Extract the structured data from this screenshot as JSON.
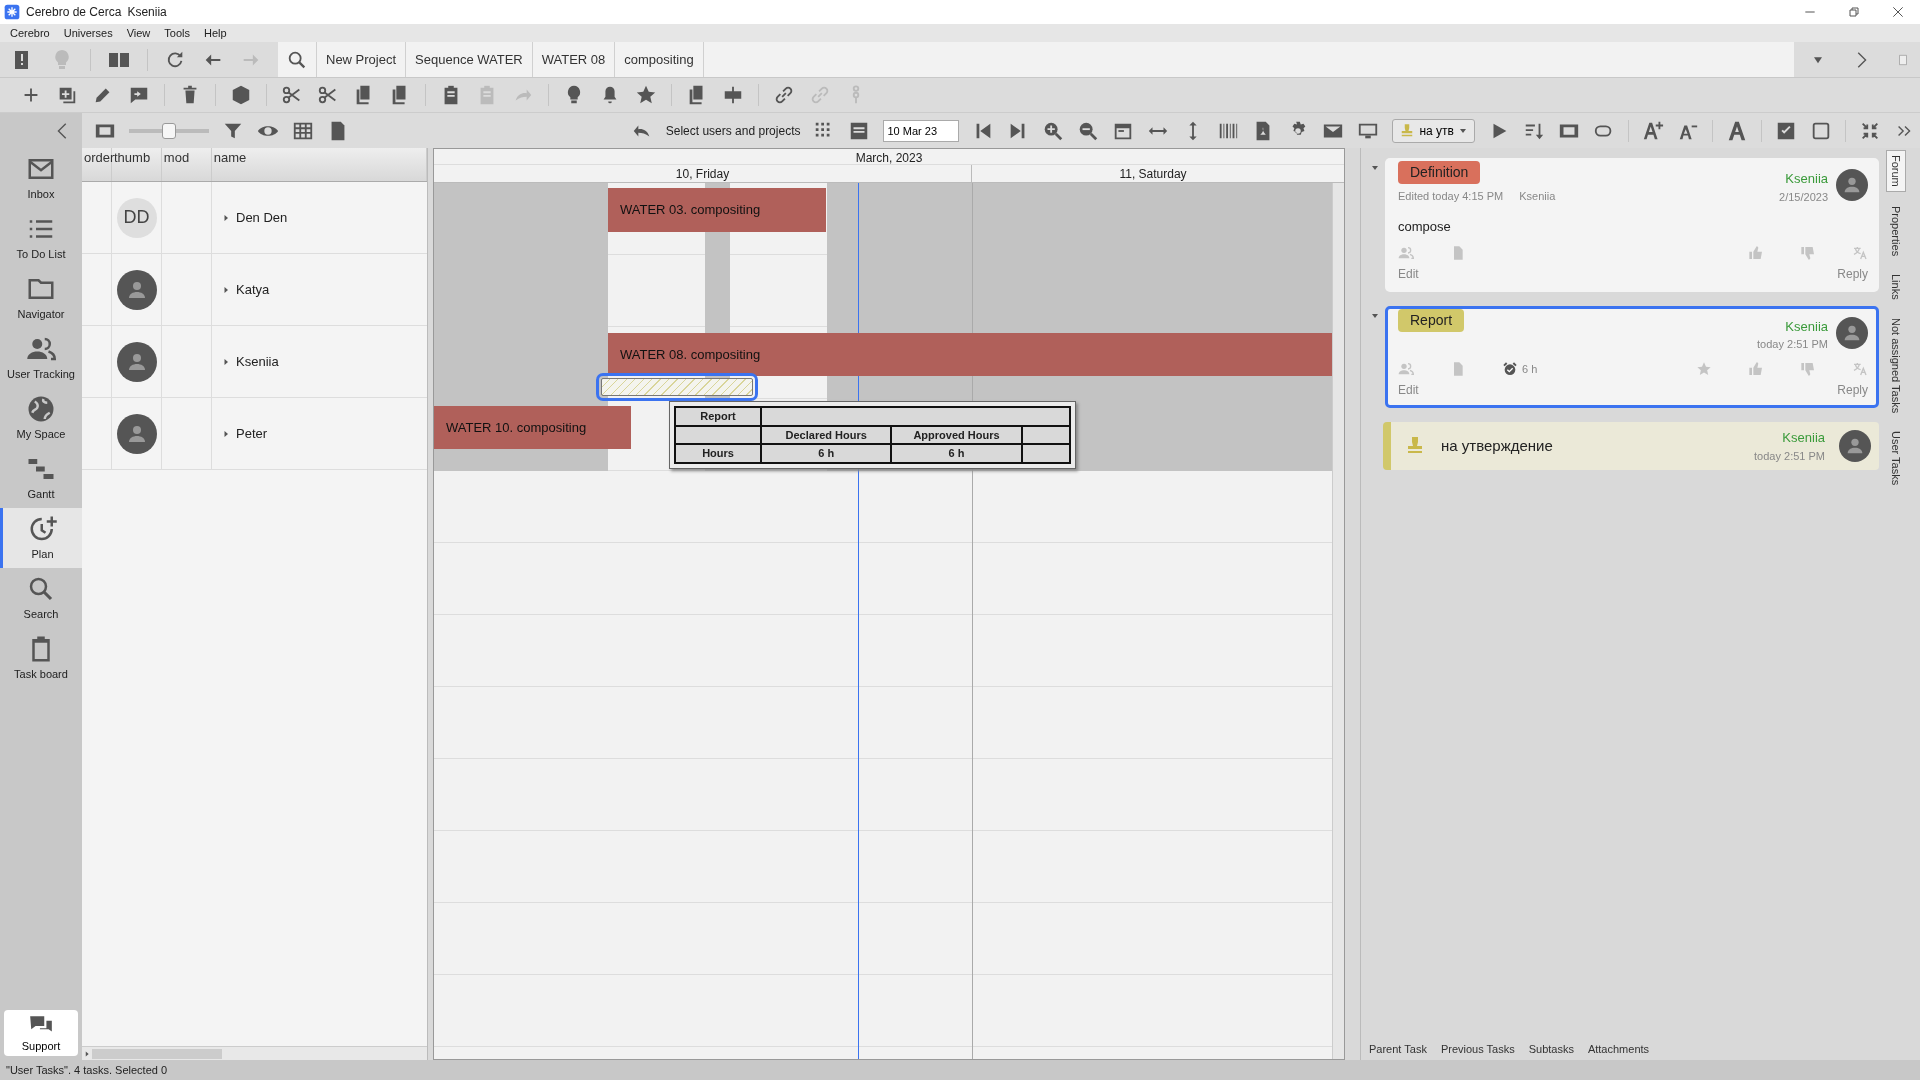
{
  "window": {
    "title": "Cerebro de Cerca",
    "user": "Kseniia"
  },
  "menu": [
    "Cerebro",
    "Universes",
    "View",
    "Tools",
    "Help"
  ],
  "breadcrumbs": [
    "New Project",
    "Sequence WATER",
    "WATER 08",
    "compositing"
  ],
  "plan_toolbar": {
    "zoom_slider": {
      "level": 0.5
    },
    "select_label": "Select users and projects",
    "date": "10 Mar 23",
    "status_filter": "на утв"
  },
  "sidebar": [
    {
      "label": "Inbox",
      "selected": false
    },
    {
      "label": "To Do List",
      "selected": false
    },
    {
      "label": "Navigator",
      "selected": false
    },
    {
      "label": "User Tracking",
      "selected": false
    },
    {
      "label": "My Space",
      "selected": false
    },
    {
      "label": "Gantt",
      "selected": false
    },
    {
      "label": "Plan",
      "selected": true
    },
    {
      "label": "Search",
      "selected": false
    },
    {
      "label": "Task board",
      "selected": false
    }
  ],
  "support": "Support",
  "grid": {
    "columns": [
      "order",
      "thumb",
      "mod",
      "name"
    ],
    "rows": [
      {
        "initials": "DD",
        "name": "Den Den",
        "tasks": [
          {
            "kind": "task",
            "label": "WATER 03. compositing"
          }
        ]
      },
      {
        "name": "Katya",
        "tasks": []
      },
      {
        "name": "Kseniia",
        "tasks": [
          {
            "kind": "task",
            "label": "WATER 08. compositing"
          },
          {
            "kind": "report",
            "selected": true
          }
        ]
      },
      {
        "name": "Peter",
        "tasks": [
          {
            "kind": "task",
            "label": "WATER 10. compositing"
          }
        ]
      }
    ]
  },
  "gantt": {
    "month": "March, 2023",
    "days": [
      "10, Friday",
      "11, Saturday"
    ],
    "tooltip": {
      "title": "Report",
      "headers": [
        "Declared Hours",
        "Approved Hours"
      ],
      "row_label": "Hours",
      "values": [
        "6 h",
        "6 h"
      ]
    }
  },
  "forum": {
    "posts": [
      {
        "kind": "message",
        "tag": "Definition",
        "color": "#d9705c",
        "expanded": true,
        "selected": false,
        "edited": "Edited today 4:15 PM",
        "editor": "Kseniia",
        "author": "Kseniia",
        "date": "2/15/2023",
        "text": "compose",
        "edit": "Edit",
        "reply": "Reply"
      },
      {
        "kind": "report",
        "tag": "Report",
        "color": "#d1c86a",
        "expanded": true,
        "selected": true,
        "hours": "6 h",
        "author": "Kseniia",
        "date": "today 2:51 PM",
        "edit": "Edit",
        "reply": "Reply"
      },
      {
        "kind": "status",
        "color": "#d1c86a",
        "text": "на утверждение",
        "author": "Kseniia",
        "date": "today 2:51 PM"
      }
    ],
    "bottom_tabs": [
      "Parent Task",
      "Previous Tasks",
      "Subtasks",
      "Attachments"
    ]
  },
  "side_tabs": [
    {
      "label": "Forum",
      "selected": true
    },
    {
      "label": "Properties",
      "selected": false
    },
    {
      "label": "Links",
      "selected": false
    },
    {
      "label": "Not assigned Tasks",
      "selected": false
    },
    {
      "label": "User Tasks",
      "selected": false
    }
  ],
  "status_bar": "\"User Tasks\". 4 tasks. Selected 0"
}
